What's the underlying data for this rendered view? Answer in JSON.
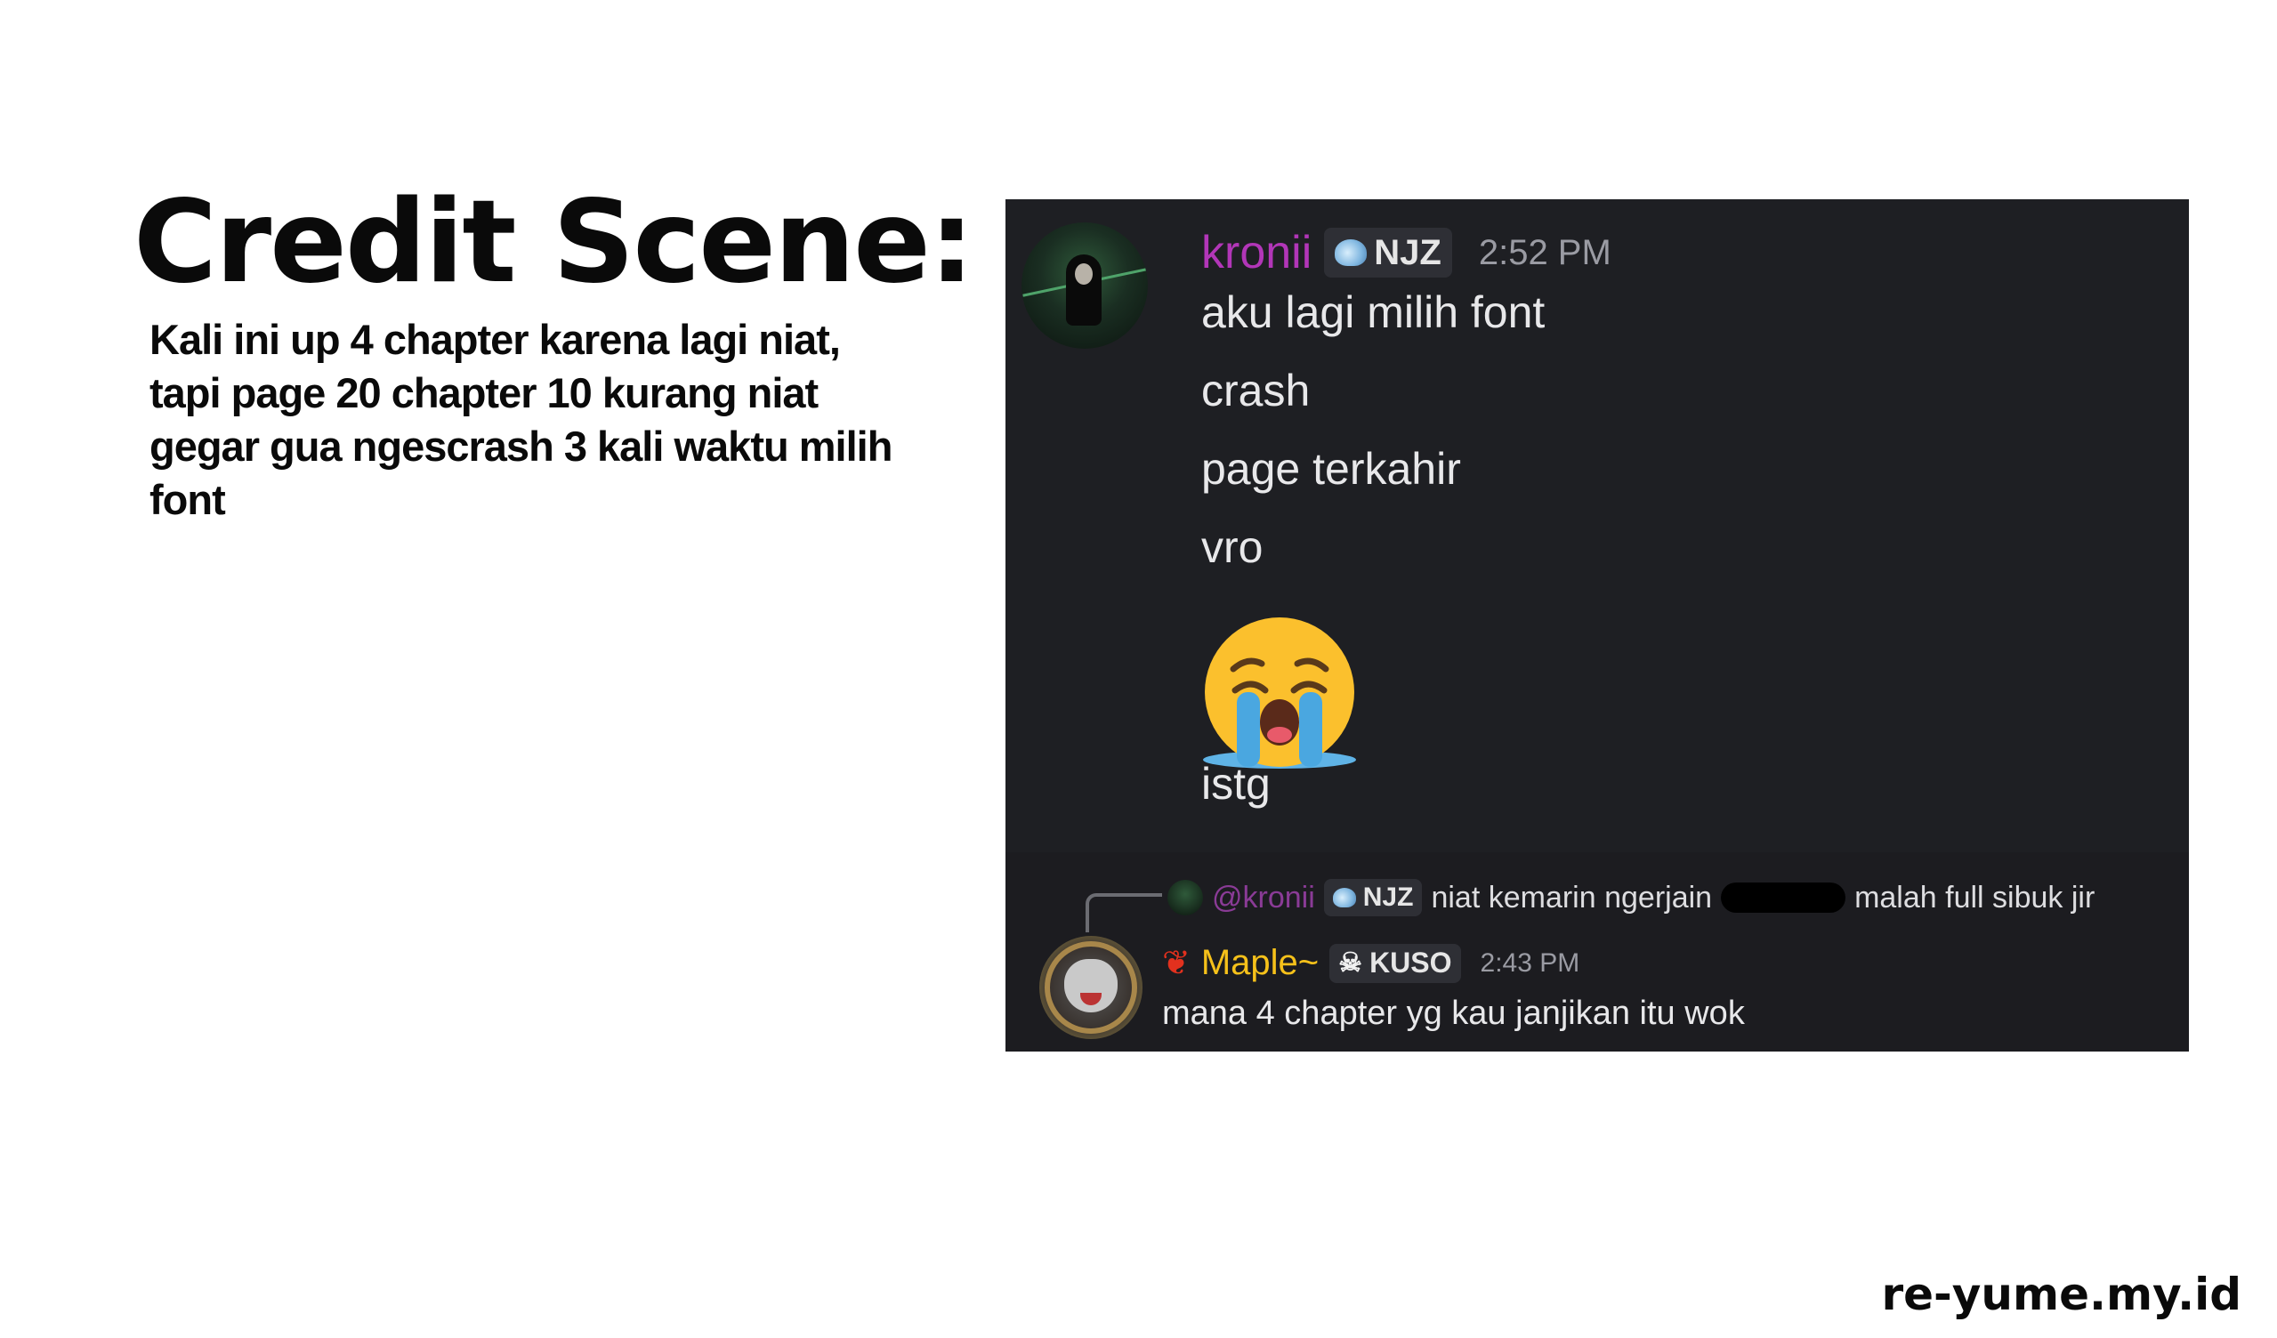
{
  "title": "Credit Scene:",
  "description": "Kali ini up 4 chapter karena lagi niat, tapi page 20 chapter 10 kurang niat gegar gua ngescrash 3 kali waktu milih font",
  "watermark": "re-yume.my.id",
  "chat": {
    "message1": {
      "username": "kronii",
      "tag": "NJZ",
      "time": "2:52 PM",
      "lines": [
        "aku lagi milih font",
        "crash",
        "page terkahir",
        "vro",
        "istg"
      ],
      "emoji": "loudly-crying-face"
    },
    "reply": {
      "username": "@kronii",
      "tag": "NJZ",
      "text_before": "niat kemarin ngerjain",
      "text_after": "malah full sibuk jir"
    },
    "message2": {
      "username": "Maple~",
      "tag": "KUSO",
      "time": "2:43 PM",
      "text": "mana 4 chapter yg kau janjikan itu wok"
    }
  }
}
